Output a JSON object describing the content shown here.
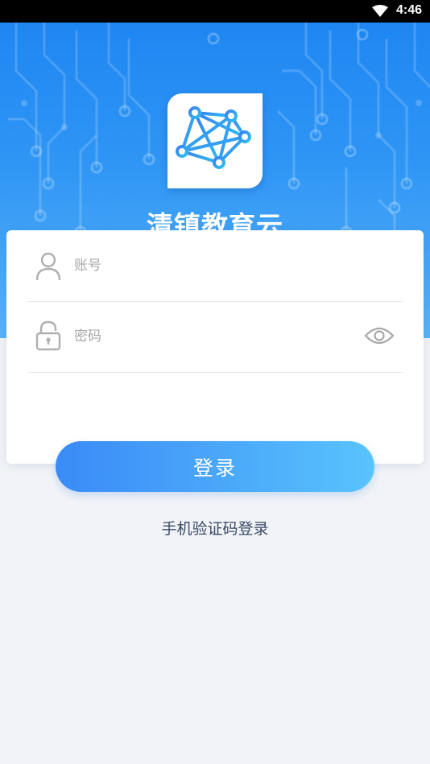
{
  "status_bar": {
    "time": "4:46",
    "wifi_icon": "wifi-icon"
  },
  "header": {
    "logo_icon": "network-logo-icon",
    "app_title": "清镇教育云"
  },
  "form": {
    "account_placeholder": "账号",
    "account_value": "",
    "account_icon": "user-icon",
    "password_placeholder": "密码",
    "password_value": "",
    "password_icon": "lock-icon",
    "visibility_icon": "eye-icon"
  },
  "actions": {
    "login_label": "登录",
    "sms_login_label": "手机验证码登录"
  },
  "colors": {
    "brand_blue": "#2f96f5",
    "button_start": "#3a8bf7",
    "button_end": "#59c4fd",
    "background": "#f1f3f6",
    "link_text": "#3b4a66"
  }
}
